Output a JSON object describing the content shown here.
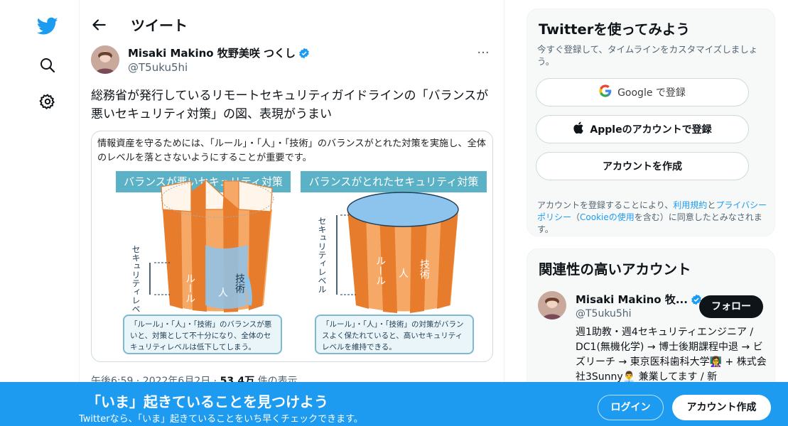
{
  "nav": {
    "icons": [
      "twitter-logo-icon",
      "search-icon",
      "gear-icon"
    ]
  },
  "header": {
    "title": "ツイート"
  },
  "tweet": {
    "author_name": "Misaki Makino 牧野美咲 つくし",
    "author_handle": "@T5uku5hi",
    "text": "総務省が発行しているリモートセキュリティガイドラインの「バランスが悪いセキュリティ対策」の図、表現がうまい",
    "meta_time": "午後6:59 · 2022年6月2日 · ",
    "meta_views": "53.4万",
    "meta_views_suffix": " 件の表示",
    "more": "···"
  },
  "figure": {
    "intro": "情報資産を守るためには、「ルール」・「人」・「技術」のバランスがとれた対策を実施し、全体のレベルを落とさないようにすることが重要です。",
    "left_title": "バランスが悪いセキュリティ対策",
    "right_title": "バランスがとれたセキュリティ対策",
    "axis_label": "セキュリティレベル",
    "stave_rule": "ルール",
    "stave_person": "人",
    "stave_tech": "技術",
    "left_caption": "「ルール」・「人」・「技術」のバランスが悪いと、対策として不十分になり、全体のセキュリティレベルは低下してしまう。",
    "right_caption": "「ルール」・「人」・「技術」の対策がバランスよく保たれていると、高いセキュリティレベルを維持できる。"
  },
  "sidebar": {
    "signup_title": "Twitterを使ってみよう",
    "signup_sub": "今すぐ登録して、タイムラインをカスタマイズしましょう。",
    "google_btn": "Google で登録",
    "apple_btn": "Appleのアカウントで登録",
    "create_btn": "アカウントを作成",
    "legal_pre": "アカウントを登録することにより、",
    "legal_terms": "利用規約",
    "legal_mid": "と",
    "legal_privacy": "プライバシーポリシー",
    "legal_cookie_pre": "（",
    "legal_cookie": "Cookieの使用",
    "legal_post": "を含む）に同意したとみなされます。",
    "related_title": "関連性の高いアカウント",
    "acc_name": "Misaki Makino 牧...",
    "acc_handle": "@T5uku5hi",
    "follow_btn": "フォロー",
    "acc_bio": "週1助教・週4セキュリティエンジニア / DC1(無機化学) → 博士後期課程中退 → ビズリーチ → 東京医科歯科大学👩‍🏫 + 株式会社3Sunny👨‍💼 兼業してます / 新"
  },
  "bottom_bar": {
    "title": "「いま」起きていることを見つけよう",
    "subtitle": "Twitterなら、「いま」起きていることをいち早くチェックできます。",
    "login_btn": "ログイン",
    "signup_btn": "アカウント作成"
  },
  "colors": {
    "accent": "#1d9bf0",
    "stave_orange": "#e77d2c",
    "stave_light": "#f6a866",
    "water": "#8cc4ee"
  }
}
